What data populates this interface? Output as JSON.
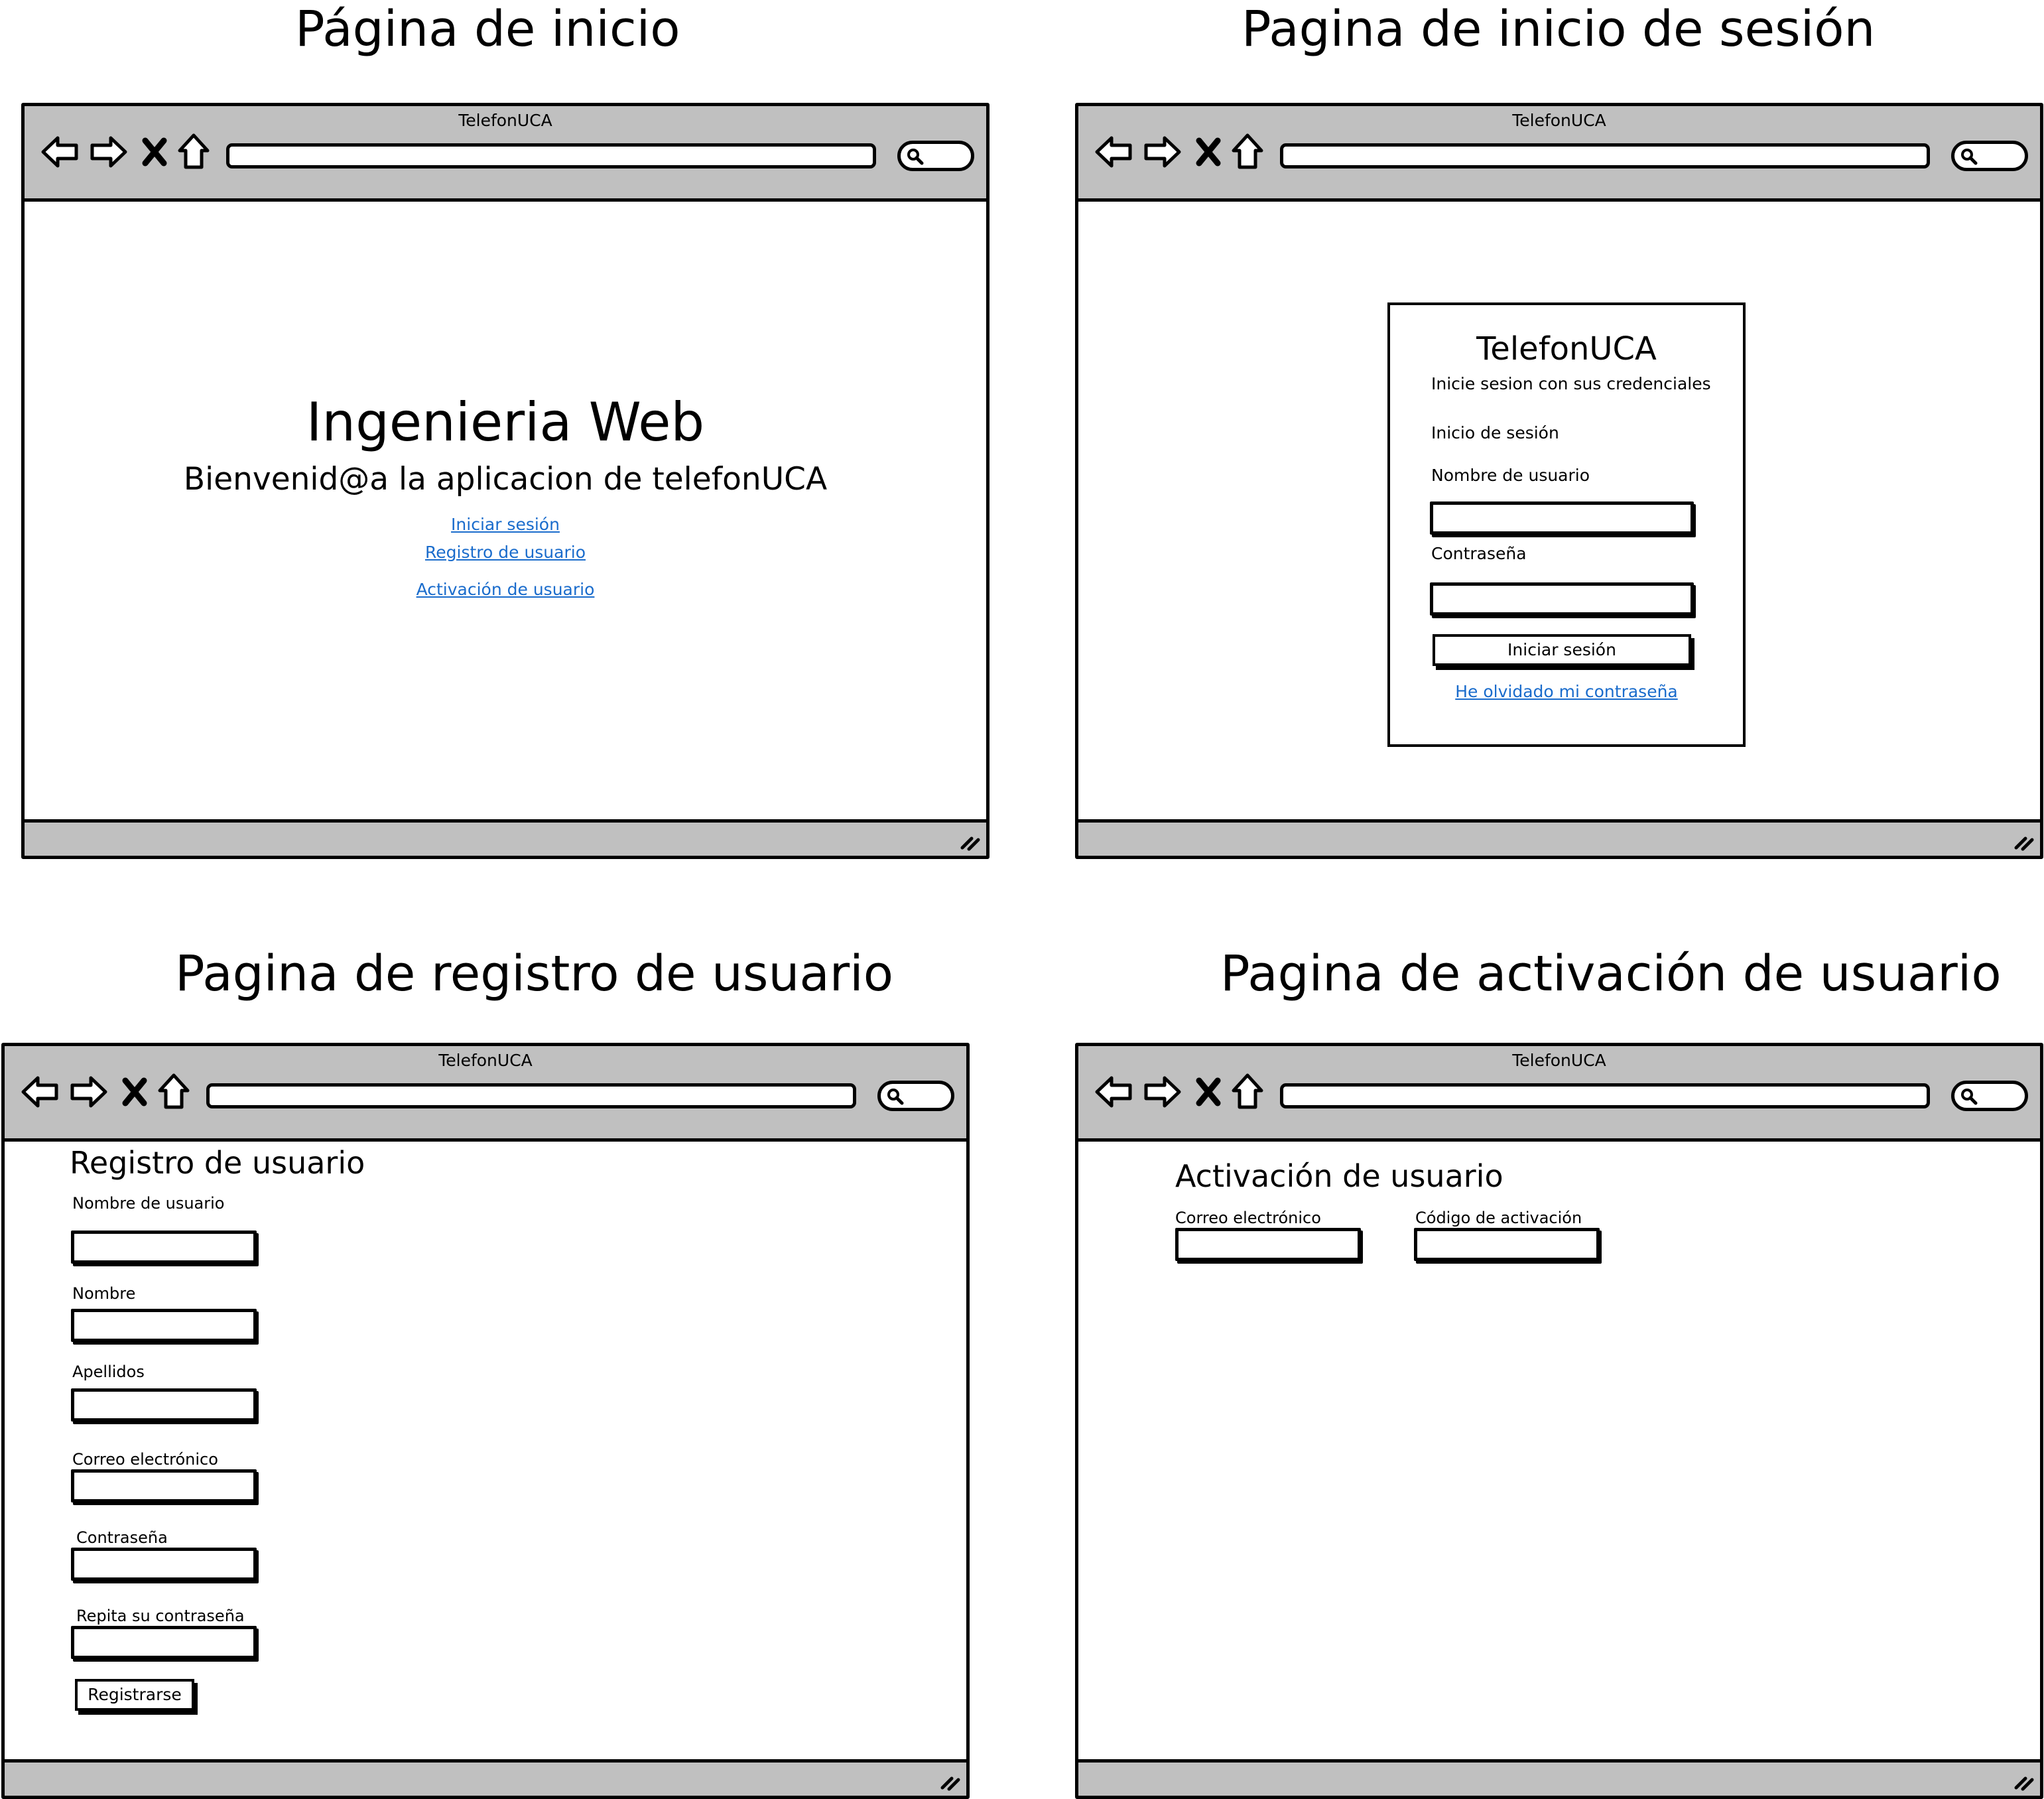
{
  "sections": {
    "home": "Página de inicio",
    "login": "Pagina de inicio de sesión",
    "register": "Pagina de registro de usuario",
    "activation": "Pagina de activación de usuario"
  },
  "browser": {
    "title": "TelefonUCA",
    "icons": [
      "arrow-left-icon",
      "arrow-right-icon",
      "close-icon",
      "home-icon",
      "search-icon",
      "resize-handle-icon"
    ],
    "chrome_color": "#c0c0c0"
  },
  "home": {
    "heading": "Ingenieria Web",
    "welcome": "Bienvenid@a la aplicacion de telefonUCA",
    "links": {
      "login": "Iniciar sesión",
      "register": "Registro de usuario",
      "activate": "Activación de usuario"
    },
    "link_color": "#1a6ccc"
  },
  "login": {
    "app_title": "TelefonUCA",
    "subtitle": "Inicie sesion con sus credenciales",
    "section": "Inicio de sesión",
    "username_label": "Nombre de usuario",
    "password_label": "Contraseña",
    "submit": "Iniciar sesión",
    "forgot": "He olvidado mi contraseña"
  },
  "register": {
    "heading": "Registro de usuario",
    "username_label": "Nombre de usuario",
    "name_label": "Nombre",
    "surname_label": "Apellidos",
    "email_label": "Correo electrónico",
    "password_label": "Contraseña",
    "repeat_label": "Repita su contraseña",
    "submit": "Registrarse"
  },
  "activation": {
    "heading": "Activación de usuario",
    "email_label": "Correo electrónico",
    "code_label": "Código de activación"
  }
}
